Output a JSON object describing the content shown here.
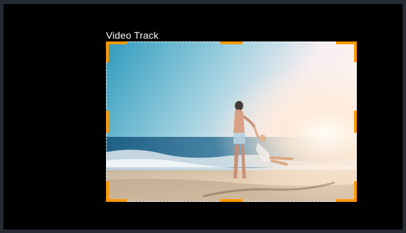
{
  "track": {
    "label": "Video Track"
  },
  "colors": {
    "frame": "#262a33",
    "canvas": "#000000",
    "handle": "#ff9900"
  },
  "icons": {
    "handles": "resize-handle-icon"
  }
}
